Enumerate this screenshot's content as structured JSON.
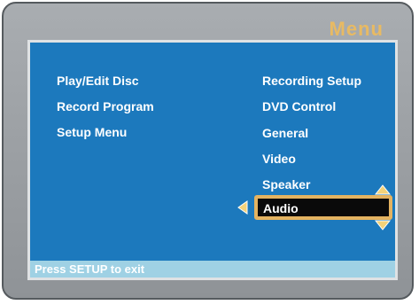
{
  "header": {
    "title": "Menu"
  },
  "main_menu": {
    "items": [
      {
        "label": "Play/Edit Disc"
      },
      {
        "label": "Record Program"
      },
      {
        "label": "Setup Menu"
      }
    ]
  },
  "setup_menu": {
    "items": [
      {
        "label": "Recording Setup"
      },
      {
        "label": "DVD Control"
      },
      {
        "label": "General"
      },
      {
        "label": "Video"
      },
      {
        "label": "Speaker"
      },
      {
        "label": "Audio",
        "selected": true
      }
    ]
  },
  "status": {
    "text": "Press SETUP to exit"
  },
  "icons": {
    "left": "triangle-left-icon",
    "up": "triangle-up-icon",
    "down": "triangle-down-icon"
  },
  "colors": {
    "title": "#e8ba63",
    "screen": "#1c79bd",
    "highlight_border": "#e4b361",
    "status_bar": "#9fd1e4"
  }
}
